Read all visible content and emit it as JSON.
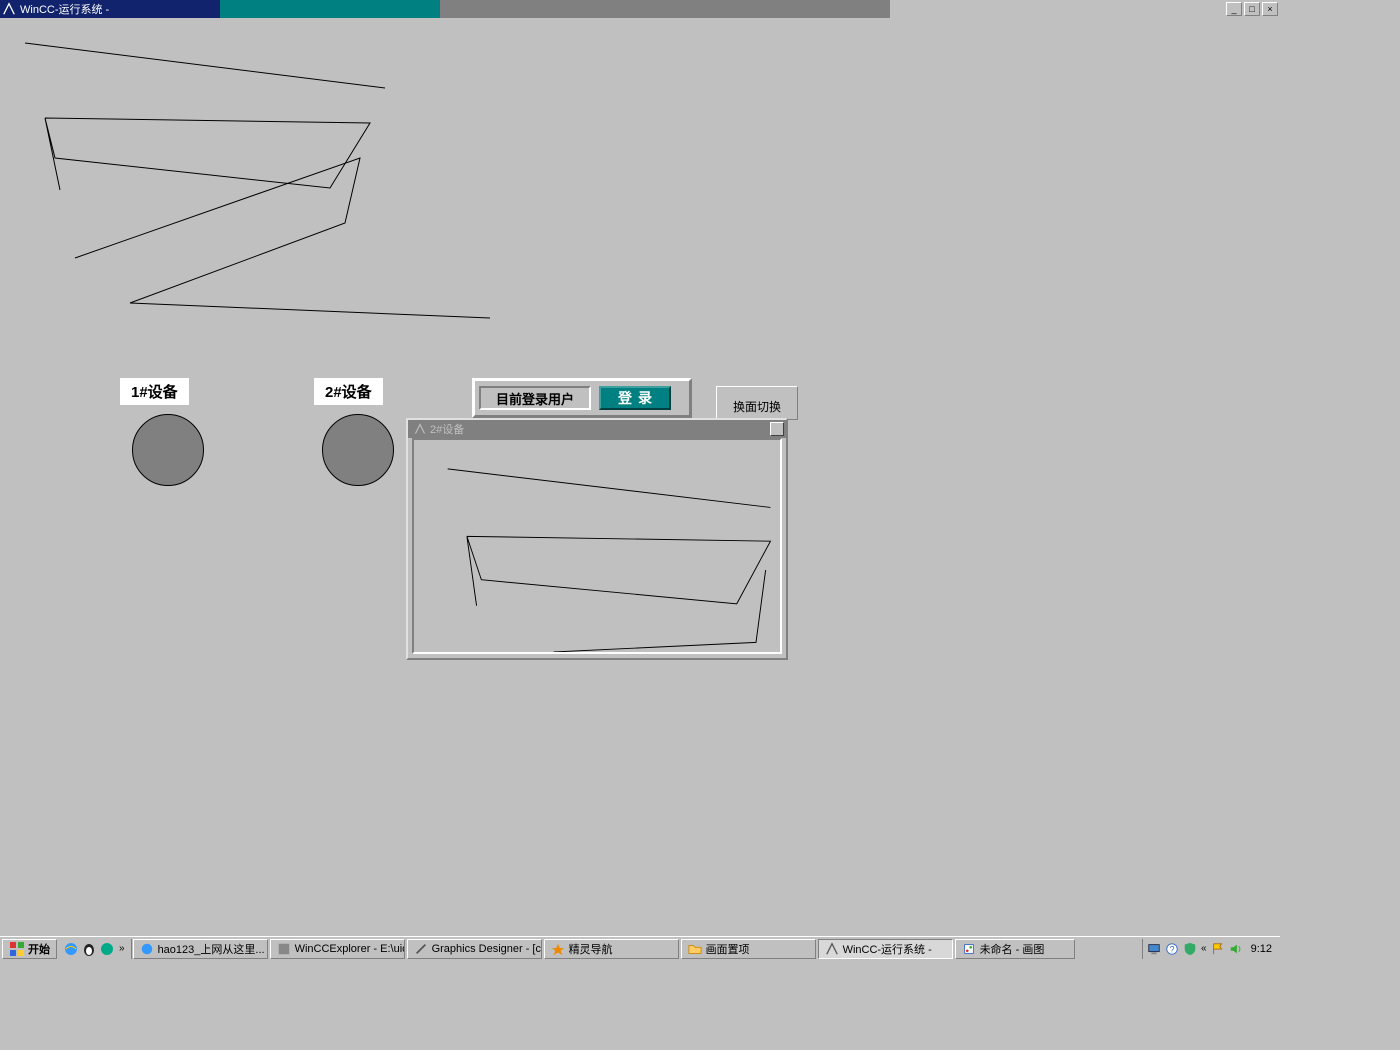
{
  "titlebar": {
    "title": "WinCC-运行系统 -"
  },
  "devices": [
    {
      "label": "1#设备"
    },
    {
      "label": "2#设备"
    }
  ],
  "panel": {
    "current_user_label": "目前登录用户",
    "login_label": "登录",
    "switch_label": "换面切换"
  },
  "subwin": {
    "title": "2#设备"
  },
  "taskbar": {
    "start": "开始",
    "chevron": "»",
    "items": [
      {
        "label": "hao123_上网从这里...",
        "active": false
      },
      {
        "label": "WinCCExplorer - E:\\uio...",
        "active": false
      },
      {
        "label": "Graphics Designer - [co...",
        "active": false
      },
      {
        "label": "精灵导航",
        "active": false
      },
      {
        "label": "画面置项",
        "active": false
      },
      {
        "label": "WinCC-运行系统 -",
        "active": true
      },
      {
        "label": "未命名 - 画图",
        "active": false
      }
    ],
    "tray_chevron": "«",
    "clock": "9:12"
  }
}
